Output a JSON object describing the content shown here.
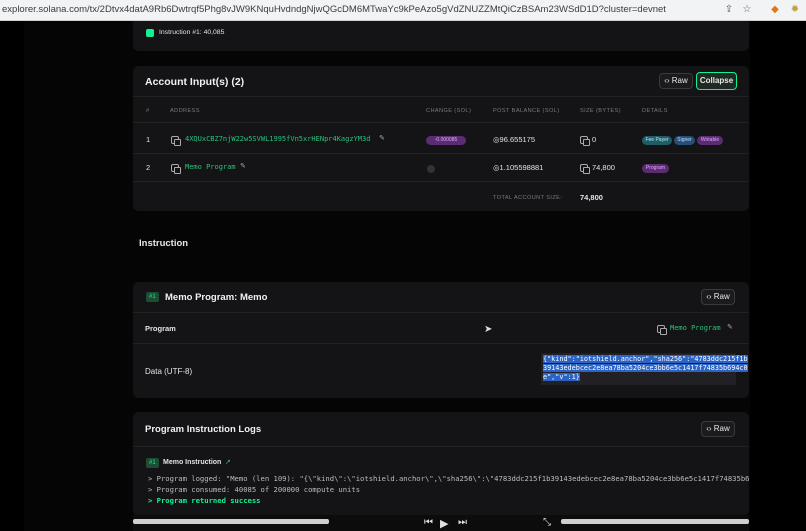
{
  "browser": {
    "url": "explorer.solana.com/tx/2Dtvx4datA9Rb6Dwtrqf5Phg8vJW9KNquHvdndgNjwQGcDM6MTwaYc9kPeAzo5gVdZNUZZMtQiCzBSAm23WSdD1D?cluster=devnet"
  },
  "top_card": {
    "instruction_text": "Instruction #1: 40,085"
  },
  "accounts": {
    "title": "Account Input(s) (2)",
    "raw_label": "Raw",
    "collapse_label": "Collapse",
    "headers": [
      "#",
      "ADDRESS",
      "CHANGE (SOL)",
      "POST BALANCE (SOL)",
      "SIZE (BYTES)",
      "DETAILS"
    ],
    "rows": [
      {
        "index": "1",
        "address": "4XQUxCBZ7njW22w5SVWL1995fVn5xrHENpr4KagzYM3d",
        "change": "-0.000085",
        "post_balance": "◎96.655175",
        "size": "0",
        "details": [
          "Fee Payer",
          "Signer",
          "Writable"
        ]
      },
      {
        "index": "2",
        "address": "Memo Program",
        "change": "",
        "post_balance": "◎1.105598881",
        "size": "74,800",
        "details": [
          "Program"
        ]
      }
    ],
    "total_label": "TOTAL ACCOUNT SIZE:",
    "total_value": "74,800"
  },
  "instruction_heading": "Instruction",
  "memo": {
    "badge": "#1",
    "title": "Memo Program: Memo",
    "raw_label": "Raw",
    "program_label": "Program",
    "program_value": "Memo Program",
    "data_label": "Data (UTF-8)",
    "data_lines": [
      "{\"kind\":\"iotshield.anchor\",\"sha256\":\"4783ddc215f1b",
      "39143edebcec2e8ea78ba5204ce3bb6e5c1417f74835b694c0",
      "e\",\"v\":1}"
    ]
  },
  "logs": {
    "title": "Program Instruction Logs",
    "raw_label": "Raw",
    "badge": "#1",
    "sub_title": "Memo Instruction",
    "lines": [
      "> Program logged: \"Memo (len 109): \"{\\\"kind\\\":\\\"iotshield.anchor\\\",\\\"sha256\\\":\\\"4783ddc215f1b39143edebcec2e8ea78ba5204ce3bb6e5c1417f74835b6",
      "> Program consumed: 40085 of 200000 compute units",
      "> Program returned success"
    ]
  },
  "colors": {
    "accent": "#14f195",
    "background": "#050505",
    "card": "#141416"
  }
}
